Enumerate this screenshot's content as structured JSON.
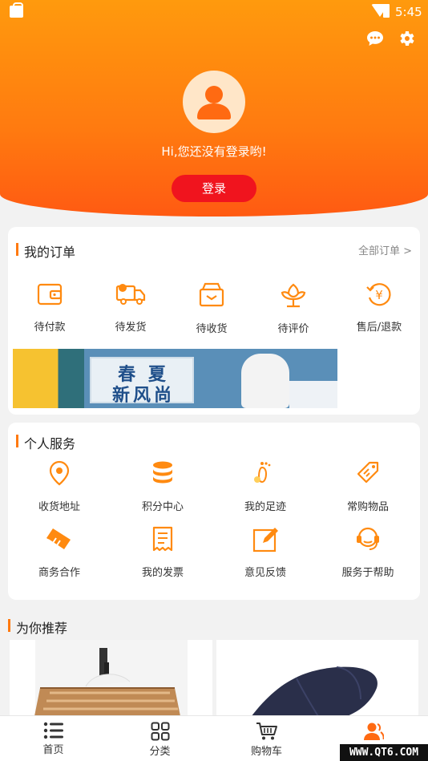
{
  "status_bar": {
    "time": "5:45"
  },
  "profile": {
    "greeting": "Hi,您还没有登录哟!",
    "login_label": "登录"
  },
  "orders": {
    "title": "我的订单",
    "all_label": "全部订单 >",
    "items": [
      {
        "label": "待付款",
        "icon": "wallet-icon"
      },
      {
        "label": "待发货",
        "icon": "truck-icon"
      },
      {
        "label": "待收货",
        "icon": "package-icon"
      },
      {
        "label": "待评价",
        "icon": "flower-icon"
      },
      {
        "label": "售后/退款",
        "icon": "refund-icon"
      }
    ],
    "banner": {
      "line1": "春 夏",
      "line2": "新风尚"
    }
  },
  "services": {
    "title": "个人服务",
    "items": [
      {
        "label": "收货地址",
        "icon": "location-icon"
      },
      {
        "label": "积分中心",
        "icon": "coins-icon"
      },
      {
        "label": "我的足迹",
        "icon": "footprint-icon"
      },
      {
        "label": "常购物品",
        "icon": "tag-icon"
      },
      {
        "label": "商务合作",
        "icon": "handshake-icon"
      },
      {
        "label": "我的发票",
        "icon": "invoice-icon"
      },
      {
        "label": "意见反馈",
        "icon": "edit-icon"
      },
      {
        "label": "服务于帮助",
        "icon": "headset-icon"
      }
    ]
  },
  "recommend": {
    "title": "为你推荐"
  },
  "tabbar": {
    "tabs": [
      {
        "label": "首页",
        "icon": "list-icon"
      },
      {
        "label": "分类",
        "icon": "grid-icon"
      },
      {
        "label": "购物车",
        "icon": "cart-icon"
      },
      {
        "label": "",
        "icon": "user-icon",
        "active": true
      }
    ]
  },
  "watermark": "WWW.QT6.COM",
  "colors": {
    "accent": "#ff7a10",
    "login": "#f0141e",
    "header_top": "#ff9a0d"
  }
}
